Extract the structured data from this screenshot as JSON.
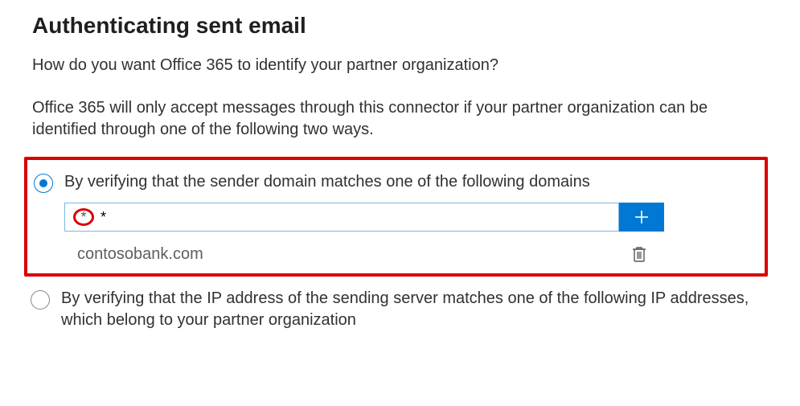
{
  "header": {
    "title": "Authenticating sent email",
    "question": "How do you want Office 365 to identify your partner organization?",
    "description": "Office 365 will only accept messages through this connector if your partner organization can be identified through one of the following two ways."
  },
  "options": {
    "byDomain": {
      "label": "By verifying that the sender domain matches one of the following domains",
      "selected": true,
      "input_value": "*",
      "domains": [
        "contosobank.com"
      ]
    },
    "byIp": {
      "label": "By verifying that the IP address of the sending server matches one of the following IP addresses, which belong to your partner organization",
      "selected": false
    }
  },
  "icons": {
    "plus": "plus-icon",
    "trash": "trash-icon"
  },
  "colors": {
    "accent": "#0078d4",
    "annotation": "#d90000"
  }
}
